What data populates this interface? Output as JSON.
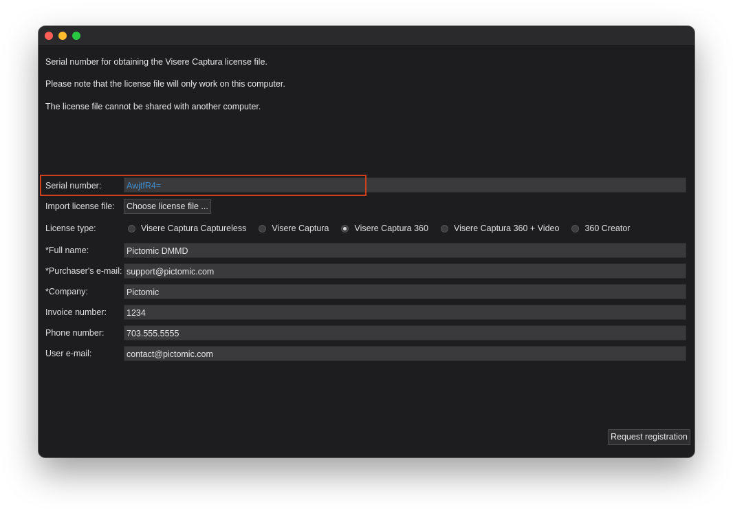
{
  "info": {
    "line1": "Serial number for obtaining the Visere Captura license file.",
    "line2": "Please note that the license file will only work on this computer.",
    "line3": "The license file cannot be shared with another computer."
  },
  "serial": {
    "label": "Serial number:",
    "value": "AwjtfR4="
  },
  "import": {
    "label": "Import license file:",
    "button": "Choose license file ..."
  },
  "license_type": {
    "label": "License type:",
    "options": [
      {
        "label": "Visere Captura Captureless",
        "checked": false
      },
      {
        "label": "Visere Captura",
        "checked": false
      },
      {
        "label": "Visere Captura 360",
        "checked": true
      },
      {
        "label": "Visere Captura 360 + Video",
        "checked": false
      },
      {
        "label": "360 Creator",
        "checked": false
      }
    ]
  },
  "fields": {
    "full_name": {
      "label": "*Full name:",
      "value": "Pictomic DMMD"
    },
    "purchaser_email": {
      "label": "*Purchaser's e-mail:",
      "value": "support@pictomic.com"
    },
    "company": {
      "label": "*Company:",
      "value": "Pictomic"
    },
    "invoice": {
      "label": "Invoice number:",
      "value": "1234"
    },
    "phone": {
      "label": "Phone number:",
      "value": "703.555.5555"
    },
    "user_email": {
      "label": "User e-mail:",
      "value": "contact@pictomic.com"
    }
  },
  "actions": {
    "request_registration": "Request registration"
  },
  "colors": {
    "highlight": "#d0401c",
    "serial_text": "#3f8fd1",
    "window_bg": "#1d1d1f"
  }
}
